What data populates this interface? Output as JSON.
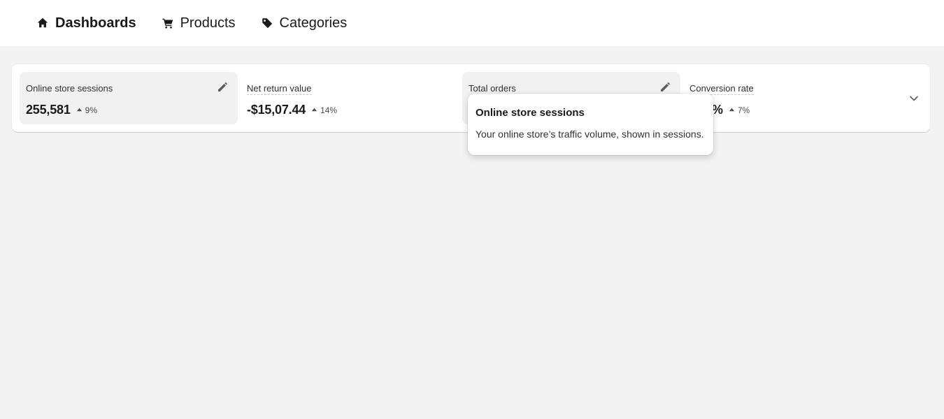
{
  "nav": {
    "items": [
      {
        "label": "Dashboards",
        "icon": "home-icon",
        "active": true
      },
      {
        "label": "Products",
        "icon": "cart-icon",
        "active": false
      },
      {
        "label": "Categories",
        "icon": "tag-icon",
        "active": false
      }
    ]
  },
  "metrics": [
    {
      "label": "Online store sessions",
      "value": "255,581",
      "trend": "9%",
      "trend_direction": "up"
    },
    {
      "label": "Net return value",
      "value": "-$15,07.44",
      "trend": "14%",
      "trend_direction": "up"
    },
    {
      "label": "Total orders",
      "value": "",
      "trend": "",
      "trend_direction": "up"
    },
    {
      "label": "Conversion rate",
      "value": "%",
      "trend": "7%",
      "trend_direction": "up"
    }
  ],
  "tooltip": {
    "title": "Online store sessions",
    "body": "Your online store’s traffic volume, shown in sessions."
  },
  "colors": {
    "page_background": "#f3f3f3",
    "card_background": "#ffffff",
    "highlight_background": "#f1f1f1"
  }
}
